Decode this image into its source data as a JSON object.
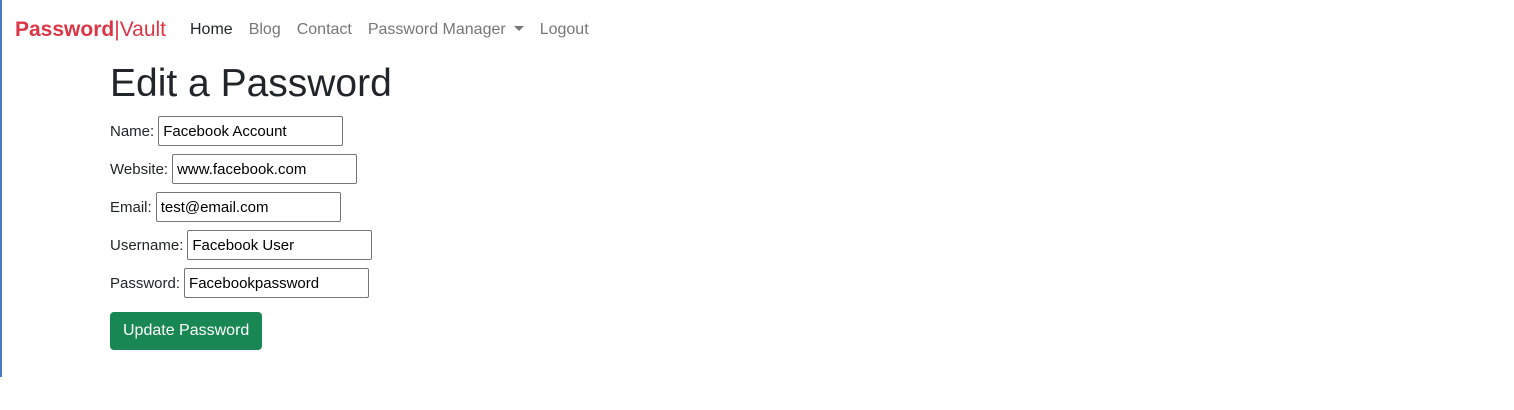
{
  "brand": {
    "bold": "Password",
    "separator": "|",
    "light": "Vault",
    "color": "#dc3545"
  },
  "nav": {
    "home": "Home",
    "blog": "Blog",
    "contact": "Contact",
    "password_manager": "Password Manager",
    "logout": "Logout"
  },
  "page": {
    "title": "Edit a Password"
  },
  "form": {
    "name_label": "Name:",
    "name_value": "Facebook Account",
    "website_label": "Website:",
    "website_value": "www.facebook.com",
    "email_label": "Email:",
    "email_value": "test@email.com",
    "username_label": "Username:",
    "username_value": "Facebook User",
    "password_label": "Password:",
    "password_value": "Facebookpassword",
    "submit_label": "Update Password"
  },
  "colors": {
    "primary_button": "#198754",
    "accent_rule": "#4a78c2"
  },
  "icons": {
    "dropdown": "chevron-down-icon"
  }
}
